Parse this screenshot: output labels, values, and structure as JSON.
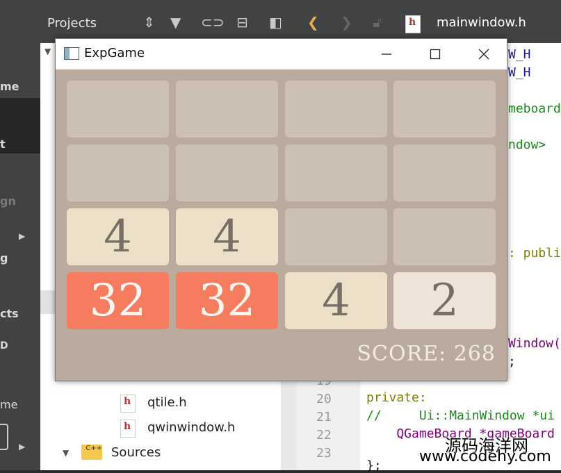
{
  "ide": {
    "pane_title": "Projects",
    "editor_file": "mainwindow.h",
    "modes": [
      "me",
      "t",
      "gn",
      "g",
      "cts",
      "D",
      "me"
    ],
    "tree_items": [
      {
        "name": "qtile.h"
      },
      {
        "name": "qwinwindow.h"
      }
    ],
    "sources_label": "Sources",
    "line_numbers": [
      "19",
      "20",
      "21",
      "22",
      "23"
    ],
    "code_fragments": {
      "l1": "W_H",
      "l2": "W_H",
      "l3": "meboard",
      "l4": "ndow>",
      "l5": ": publi",
      "l6": "Window(",
      "l7": ";",
      "l20": "private:",
      "l21": "//     Ui::MainWindow *ui",
      "l22": "    QGameBoard *gameBoard",
      "l23": "};"
    },
    "watermark_cn": "源码海洋网",
    "watermark_url": "www.codehy.com"
  },
  "window": {
    "title": "ExpGame"
  },
  "board": {
    "tiles": [
      [
        "",
        "",
        "",
        ""
      ],
      [
        "",
        "",
        "",
        ""
      ],
      [
        "4",
        "4",
        "",
        ""
      ],
      [
        "32",
        "32",
        "4",
        "2"
      ]
    ],
    "colors": {
      "empty": "#ccc0b3",
      "2": "#eee4da",
      "4": "#ede0c8",
      "32": "#f67c5f",
      "dark_text": "#776e65",
      "light_text": "#f9f6f2"
    }
  },
  "score": {
    "text": "SCORE: 268"
  }
}
